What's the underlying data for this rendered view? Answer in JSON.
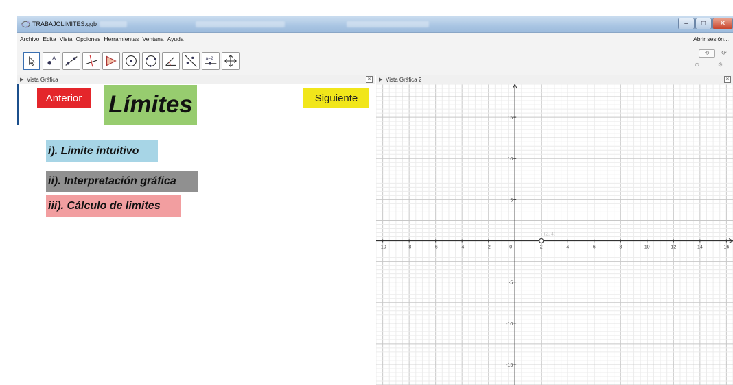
{
  "window": {
    "title": "TRABAJOLIMITES.ggb",
    "controls": {
      "minimize": "–",
      "maximize": "□",
      "close": "✕"
    }
  },
  "menu": {
    "items": [
      "Archivo",
      "Edita",
      "Vista",
      "Opciones",
      "Herramientas",
      "Ventana",
      "Ayuda"
    ],
    "signin": "Abrir sesión..."
  },
  "toolbar": {
    "tools": [
      {
        "icon": "pointer-icon",
        "active": true
      },
      {
        "icon": "point-icon",
        "active": false
      },
      {
        "icon": "line-icon",
        "active": false
      },
      {
        "icon": "perpendicular-icon",
        "active": false
      },
      {
        "icon": "polygon-icon",
        "active": false
      },
      {
        "icon": "circle-center-icon",
        "active": false
      },
      {
        "icon": "circle-three-points-icon",
        "active": false
      },
      {
        "icon": "angle-icon",
        "active": false
      },
      {
        "icon": "reflect-icon",
        "active": false
      },
      {
        "icon": "slider-icon",
        "active": false
      },
      {
        "icon": "move-view-icon",
        "active": false
      }
    ],
    "undo_label": "⟲",
    "redo_label": "⟳"
  },
  "left_panel": {
    "header": "Vista Gráfica",
    "btn_prev": "Anterior",
    "btn_next": "Siguiente",
    "title": "Límites",
    "items": [
      "i). Limite intuitivo",
      "ii). Interpretación gráfica",
      "iii). Cálculo de limites"
    ]
  },
  "right_panel": {
    "header": "Vista Gráfica 2"
  },
  "graph": {
    "xlim": [
      -10.5,
      16.5
    ],
    "ylim": [
      -17.5,
      19
    ],
    "grid": true,
    "x_ticks": [
      -10,
      -8,
      -6,
      -4,
      -2,
      0,
      2,
      4,
      6,
      8,
      10,
      12,
      14,
      16
    ],
    "y_ticks": [
      -15,
      -10,
      -5,
      5,
      10,
      15
    ],
    "open_point": {
      "x": 2,
      "y": 0
    },
    "point_label": "(2, 4)"
  },
  "colors": {
    "prev": "#e4262b",
    "next": "#f1e61a",
    "title_bg": "#97cc6f",
    "item1": "#a7d5e6",
    "item2": "#909090",
    "item3": "#f29ea0"
  }
}
